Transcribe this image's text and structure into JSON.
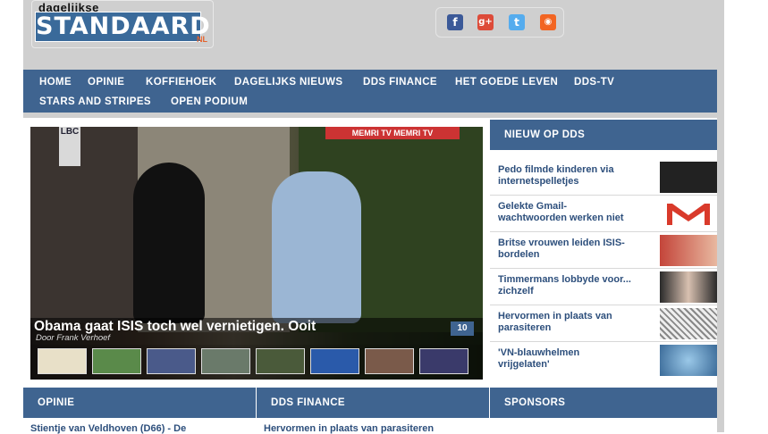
{
  "header": {
    "logo_small": "dagelijkse",
    "logo_main": "STANDAARD",
    "logo_suffix": "NL",
    "social": [
      {
        "icon": "facebook-icon",
        "glyph": "f",
        "color": "#3b5998"
      },
      {
        "icon": "google-plus-icon",
        "glyph": "g+",
        "color": "#dd4b39"
      },
      {
        "icon": "twitter-icon",
        "glyph": "t",
        "color": "#55acee"
      },
      {
        "icon": "rss-icon",
        "glyph": "◉",
        "color": "#f26522"
      }
    ]
  },
  "nav": {
    "items": [
      "HOME",
      "OPINIE",
      "KOFFIEHOEK",
      "DAGELIJKS NIEUWS",
      "DDS FINANCE",
      "HET GOEDE LEVEN",
      "DDS-TV",
      "STARS AND STRIPES",
      "OPEN PODIUM"
    ]
  },
  "hero": {
    "title": "Obama gaat ISIS toch wel vernietigen. Ooit",
    "author": "Door Frank Verhoef",
    "comments": "10",
    "lbc_label": "LBC",
    "memri_label": "MEMRI TV   MEMRI TV",
    "thumbs": [
      "#e8e0c8",
      "#5a8a4a",
      "#4a5a8a",
      "#6a7a6a",
      "#4a5a3a",
      "#2a5aaa",
      "#7a5a4a",
      "#5a3a2a",
      "#3a3a6a"
    ]
  },
  "sidebar": {
    "heading": "NIEUW OP DDS",
    "items": [
      {
        "label": "Pedo filmde kinderen via internetspelletjes",
        "img_color": "#222222"
      },
      {
        "label": "Gelekte Gmail-wachtwoorden werken niet",
        "img_color": "#d93a2b"
      },
      {
        "label": "Britse vrouwen leiden ISIS-bordelen",
        "img_color": "#c4453a"
      },
      {
        "label": "Timmermans lobbyde voor... zichzelf",
        "img_color": "#3a3a3a"
      },
      {
        "label": "Hervormen in plaats van parasiteren",
        "img_color": "#dddddd"
      },
      {
        "label": "'VN-blauwhelmen vrijgelaten'",
        "img_color": "#5a9ac8"
      }
    ]
  },
  "sections": {
    "opinie": {
      "heading": "OPINIE",
      "link": "Stientje van Veldhoven (D66) - De"
    },
    "finance": {
      "heading": "DDS FINANCE",
      "link": "Hervormen in plaats van parasiteren"
    },
    "sponsors": {
      "heading": "SPONSORS"
    }
  },
  "colors": {
    "accent": "#3f6490",
    "link": "#2d4f7c",
    "background": "#cfcfcf"
  }
}
